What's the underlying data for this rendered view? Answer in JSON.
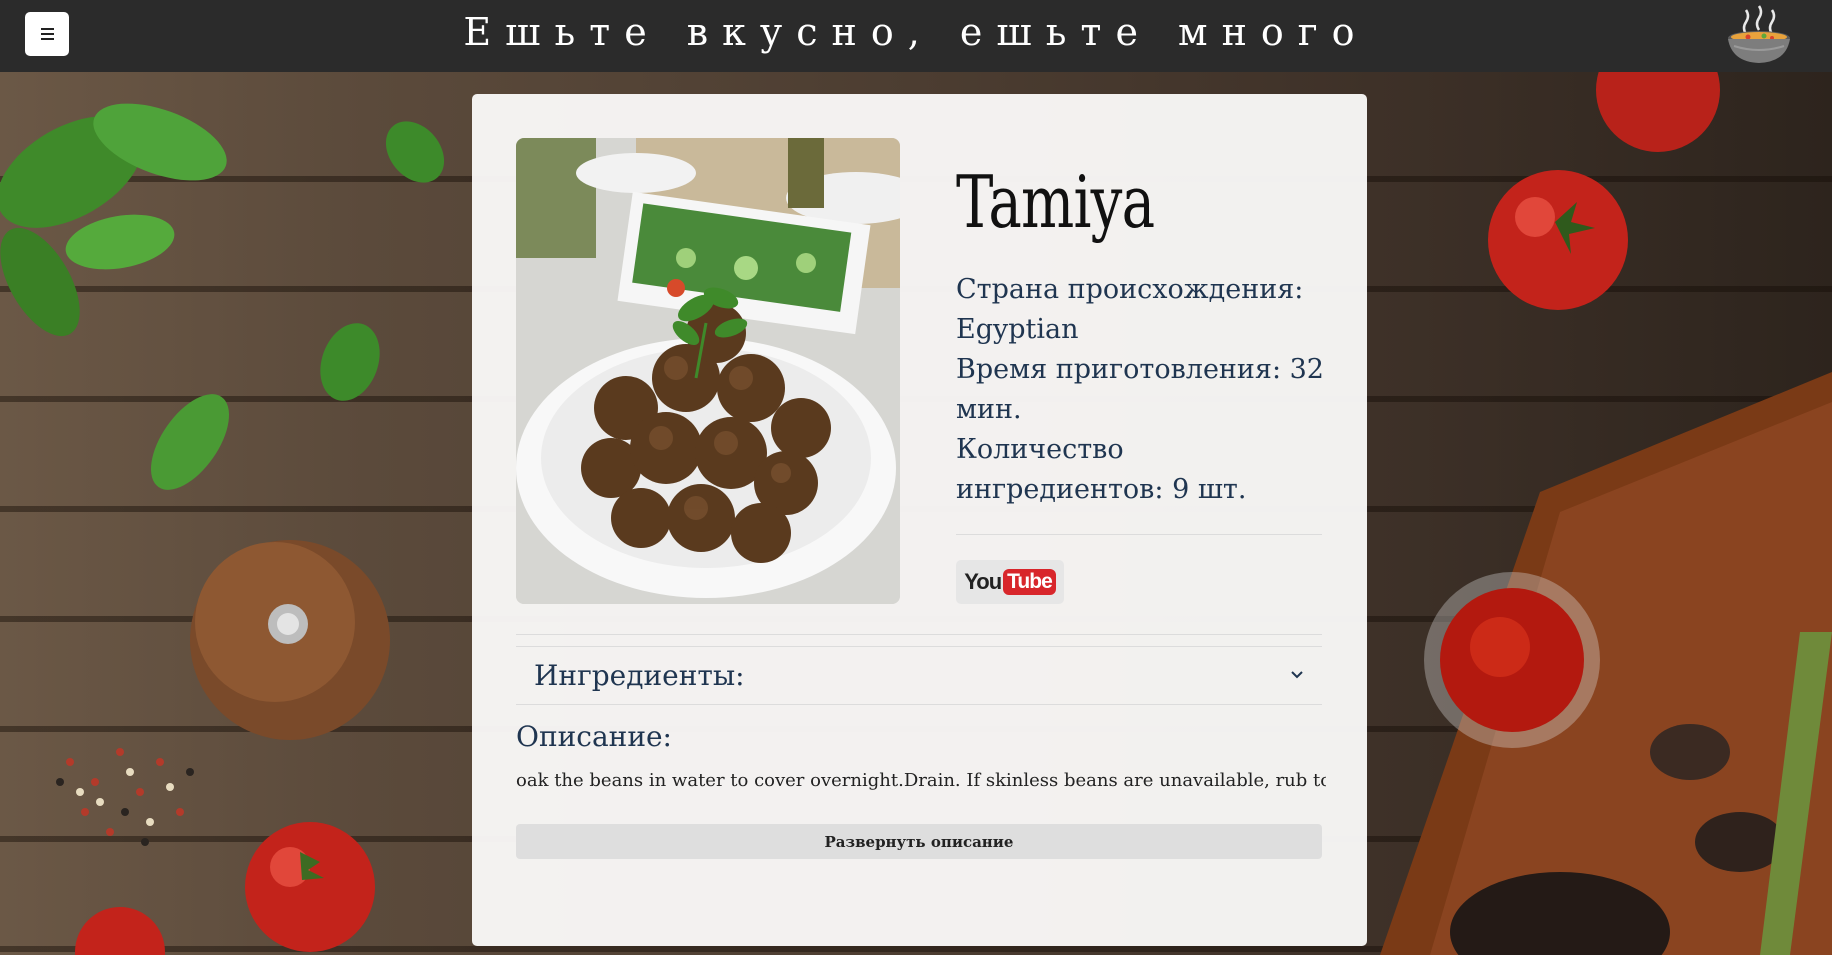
{
  "header": {
    "title": "Ешьте вкусно, ешьте много",
    "menu_icon": "hamburger-menu-icon",
    "logo_icon": "steaming-bowl-logo"
  },
  "recipe": {
    "name": "Tamiya",
    "country_label": "Страна происхождения:",
    "country_value": "Egyptian",
    "time_label": "Время приготовления: 32 мин.",
    "ingredients_count_label": "Количество ингредиентов: 9 шт.",
    "youtube": {
      "you": "You",
      "tube": "Tube"
    },
    "ingredients_section_title": "Ингредиенты:",
    "description_heading": "Описание:",
    "description_text": "oak the beans in water to cover overnight.Drain. If skinless beans are unavailable, rub to loosen",
    "expand_button_label": "Развернуть описание"
  },
  "colors": {
    "header_bg": "#2b2b2b",
    "text_blue": "#1f3550",
    "youtube_red": "#d8262b"
  }
}
